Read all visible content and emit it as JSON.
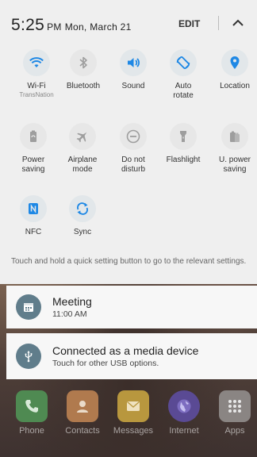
{
  "status": {
    "time": "5:25",
    "ampm": "PM",
    "date": "Mon, March 21",
    "edit_label": "EDIT"
  },
  "quick_settings": {
    "wifi": {
      "label": "Wi-Fi",
      "sub": "TransNation"
    },
    "bluetooth": {
      "label": "Bluetooth"
    },
    "sound": {
      "label": "Sound"
    },
    "auto_rotate": {
      "label_line1": "Auto",
      "label_line2": "rotate"
    },
    "location": {
      "label": "Location"
    },
    "power_saving": {
      "label_line1": "Power",
      "label_line2": "saving"
    },
    "airplane": {
      "label_line1": "Airplane",
      "label_line2": "mode"
    },
    "dnd": {
      "label_line1": "Do not",
      "label_line2": "disturb"
    },
    "flashlight": {
      "label": "Flashlight"
    },
    "u_power": {
      "label_line1": "U. power",
      "label_line2": "saving"
    },
    "nfc": {
      "label": "NFC"
    },
    "sync": {
      "label": "Sync"
    }
  },
  "hint": "Touch and hold a quick setting button to go to the relevant settings.",
  "notifications": [
    {
      "title": "Meeting",
      "subtitle": "11:00 AM",
      "icon": "calendar-icon"
    },
    {
      "title": "Connected as a media device",
      "subtitle": "Touch for other USB options.",
      "icon": "usb-icon"
    }
  ],
  "dock": [
    {
      "name": "Phone",
      "icon": "phone-icon",
      "color": "#3fa34d"
    },
    {
      "name": "Contacts",
      "icon": "contacts-icon",
      "color": "#e08a3c"
    },
    {
      "name": "Messages",
      "icon": "messages-icon",
      "color": "#f2c230"
    },
    {
      "name": "Internet",
      "icon": "internet-icon",
      "color": "#6a4fc7"
    },
    {
      "name": "Apps",
      "icon": "apps-icon",
      "color": "#9a9a9a"
    }
  ],
  "colors": {
    "accent_blue": "#1e88e5",
    "icon_grey": "#9e9e9e",
    "notif_icon_bg": "#607d8b"
  }
}
